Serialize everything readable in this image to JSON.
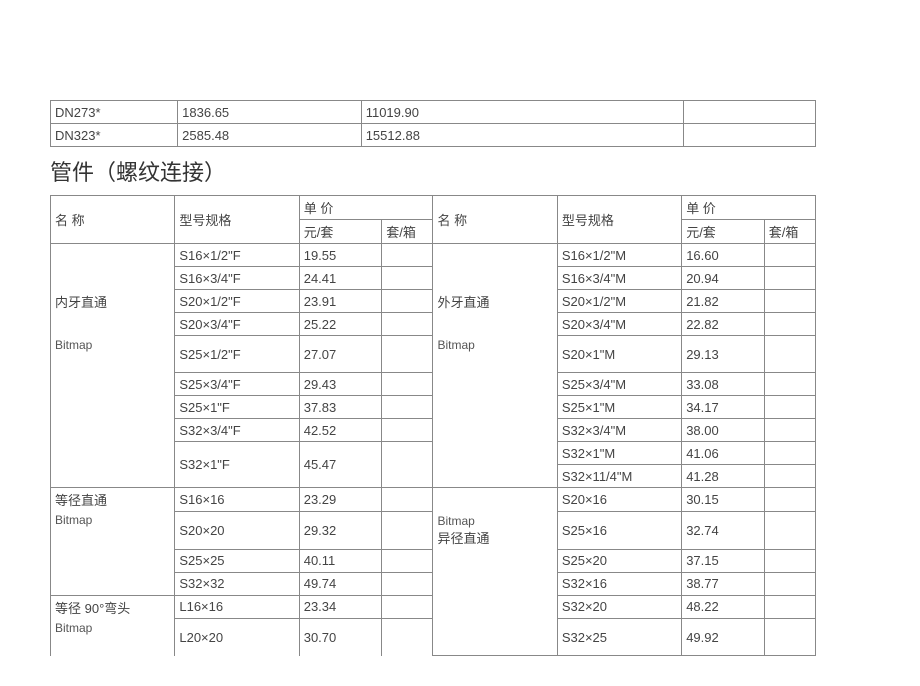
{
  "topTable": {
    "rows": [
      {
        "c1": "DN273*",
        "c2": "1836.65",
        "c3": "11019.90",
        "c4": ""
      },
      {
        "c1": "DN323*",
        "c2": "2585.48",
        "c3": "15512.88",
        "c4": ""
      }
    ]
  },
  "sectionTitle": "管件（螺纹连接）",
  "header": {
    "name": "名 称",
    "spec": "型号规格",
    "price": "单 价",
    "priceUnit": "元/套",
    "priceBox": "套/箱"
  },
  "groups": {
    "g1_name": "内牙直通",
    "g1_bitmap": "Bitmap",
    "g2_name": "外牙直通",
    "g2_bitmap": "Bitmap",
    "g3_name": "等径直通",
    "g3_bitmap": "Bitmap",
    "g4_name": "异径直通",
    "g4_bitmap": "Bitmap",
    "g5_name": "等径 90°弯头",
    "g5_bitmap": "Bitmap"
  },
  "rows": {
    "r1": {
      "lspec": "S16×1/2\"F",
      "lprice": "19.55",
      "rspec": "S16×1/2\"M",
      "rprice": "16.60"
    },
    "r2": {
      "lspec": "S16×3/4\"F",
      "lprice": "24.41",
      "rspec": "S16×3/4\"M",
      "rprice": "20.94"
    },
    "r3": {
      "lspec": "S20×1/2\"F",
      "lprice": "23.91",
      "rspec": "S20×1/2\"M",
      "rprice": "21.82"
    },
    "r4": {
      "lspec": "S20×3/4\"F",
      "lprice": "25.22",
      "rspec": "S20×3/4\"M",
      "rprice": "22.82"
    },
    "r5": {
      "lspec": "S25×1/2\"F",
      "lprice": "27.07",
      "rspec": "S20×1\"M",
      "rprice": "29.13"
    },
    "r6": {
      "lspec": "S25×3/4\"F",
      "lprice": "29.43",
      "rspec": "S25×3/4\"M",
      "rprice": "33.08"
    },
    "r7": {
      "lspec": "S25×1\"F",
      "lprice": "37.83",
      "rspec": "S25×1\"M",
      "rprice": "34.17"
    },
    "r8": {
      "lspec": "S32×3/4\"F",
      "lprice": "42.52",
      "rspec": "S32×3/4\"M",
      "rprice": "38.00"
    },
    "r9": {
      "lspec": "S32×1\"F",
      "lprice": "45.47",
      "rspec": "S32×1\"M",
      "rprice": "41.06"
    },
    "r10": {
      "lspec": "",
      "lprice": "",
      "rspec": "S32×11/4\"M",
      "rprice": "41.28"
    },
    "r11": {
      "lspec": "S16×16",
      "lprice": "23.29",
      "rspec": "S20×16",
      "rprice": "30.15"
    },
    "r12": {
      "lspec": "S20×20",
      "lprice": "29.32",
      "rspec": "S25×16",
      "rprice": "32.74"
    },
    "r13": {
      "lspec": "S25×25",
      "lprice": "40.11",
      "rspec": "S25×20",
      "rprice": "37.15"
    },
    "r14": {
      "lspec": "S32×32",
      "lprice": "49.74",
      "rspec": "S32×16",
      "rprice": "38.77"
    },
    "r15": {
      "lspec": "L16×16",
      "lprice": "23.34",
      "rspec": "S32×20",
      "rprice": "48.22"
    },
    "r16": {
      "lspec": "L20×20",
      "lprice": "30.70",
      "rspec": "S32×25",
      "rprice": "49.92"
    }
  },
  "chart_data": {
    "type": "table",
    "title": "管件（螺纹连接）价格表",
    "columns": [
      "名称",
      "型号规格",
      "元/套",
      "套/箱"
    ],
    "sections": [
      {
        "name": "内牙直通",
        "rows": [
          [
            "S16×1/2\"F",
            19.55
          ],
          [
            "S16×3/4\"F",
            24.41
          ],
          [
            "S20×1/2\"F",
            23.91
          ],
          [
            "S20×3/4\"F",
            25.22
          ],
          [
            "S25×1/2\"F",
            27.07
          ],
          [
            "S25×3/4\"F",
            29.43
          ],
          [
            "S25×1\"F",
            37.83
          ],
          [
            "S32×3/4\"F",
            42.52
          ],
          [
            "S32×1\"F",
            45.47
          ]
        ]
      },
      {
        "name": "外牙直通",
        "rows": [
          [
            "S16×1/2\"M",
            16.6
          ],
          [
            "S16×3/4\"M",
            20.94
          ],
          [
            "S20×1/2\"M",
            21.82
          ],
          [
            "S20×3/4\"M",
            22.82
          ],
          [
            "S20×1\"M",
            29.13
          ],
          [
            "S25×3/4\"M",
            33.08
          ],
          [
            "S25×1\"M",
            34.17
          ],
          [
            "S32×3/4\"M",
            38.0
          ],
          [
            "S32×1\"M",
            41.06
          ],
          [
            "S32×11/4\"M",
            41.28
          ]
        ]
      },
      {
        "name": "等径直通",
        "rows": [
          [
            "S16×16",
            23.29
          ],
          [
            "S20×20",
            29.32
          ],
          [
            "S25×25",
            40.11
          ],
          [
            "S32×32",
            49.74
          ]
        ]
      },
      {
        "name": "异径直通",
        "rows": [
          [
            "S20×16",
            30.15
          ],
          [
            "S25×16",
            32.74
          ],
          [
            "S25×20",
            37.15
          ],
          [
            "S32×16",
            38.77
          ],
          [
            "S32×20",
            48.22
          ],
          [
            "S32×25",
            49.92
          ]
        ]
      },
      {
        "name": "等径 90°弯头",
        "rows": [
          [
            "L16×16",
            23.34
          ],
          [
            "L20×20",
            30.7
          ]
        ]
      }
    ],
    "pipe_prices": [
      {
        "model": "DN273*",
        "col2": 1836.65,
        "col3": 11019.9
      },
      {
        "model": "DN323*",
        "col2": 2585.48,
        "col3": 15512.88
      }
    ]
  }
}
